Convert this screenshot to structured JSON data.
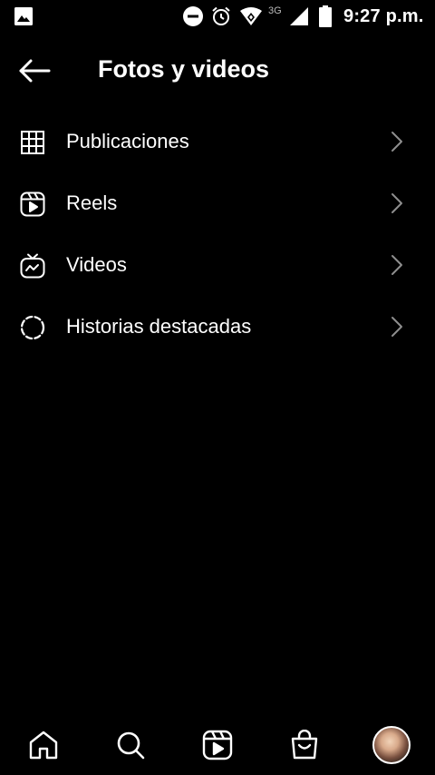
{
  "status_bar": {
    "network": "3G",
    "time": "9:27 p.m."
  },
  "header": {
    "title": "Fotos y videos"
  },
  "menu": {
    "items": [
      {
        "label": "Publicaciones",
        "icon": "grid-icon"
      },
      {
        "label": "Reels",
        "icon": "reels-icon"
      },
      {
        "label": "Videos",
        "icon": "igtv-icon"
      },
      {
        "label": "Historias destacadas",
        "icon": "highlights-icon"
      }
    ]
  },
  "bottom_nav": {
    "items": [
      "home-icon",
      "search-icon",
      "reels-icon",
      "shop-icon",
      "profile-avatar"
    ]
  },
  "colors": {
    "background": "#000000",
    "text": "#ffffff",
    "chevron": "#8e8e8e"
  }
}
